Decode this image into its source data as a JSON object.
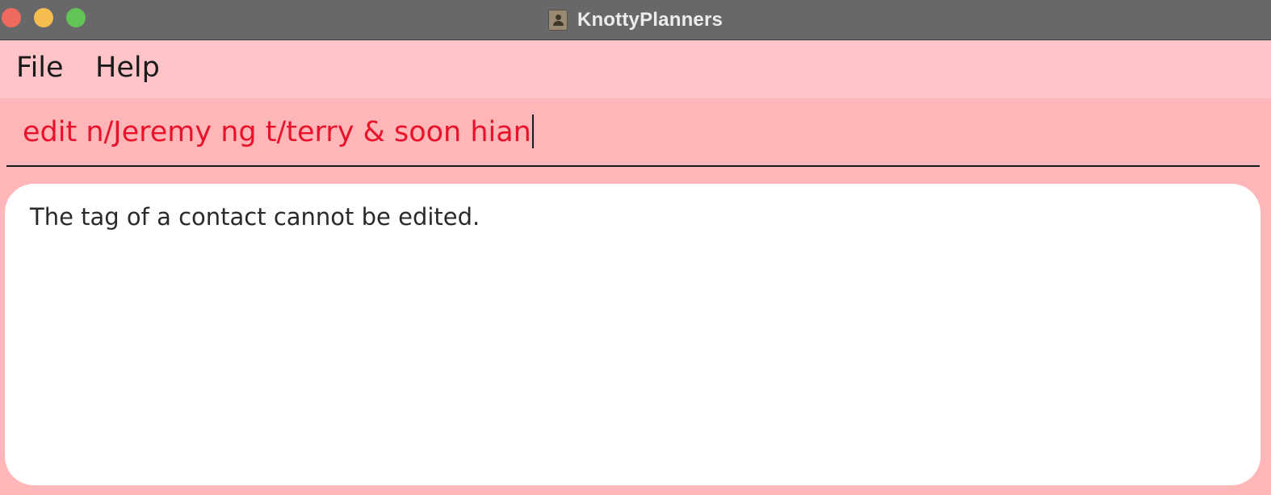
{
  "window": {
    "title": "KnottyPlanners",
    "icon": "address-book-icon",
    "controls": [
      "close",
      "minimize",
      "maximize"
    ]
  },
  "menu": {
    "items": [
      {
        "label": "File"
      },
      {
        "label": "Help"
      }
    ]
  },
  "command": {
    "value": "edit n/Jeremy ng t/terry & soon hian"
  },
  "result": {
    "message": "The tag of a contact cannot be edited."
  },
  "colors": {
    "titlebar": "#68686a",
    "menubar": "#ffc4c7",
    "background": "#ffb6b9",
    "command_text": "#e8132a",
    "result_background": "#ffffff"
  }
}
